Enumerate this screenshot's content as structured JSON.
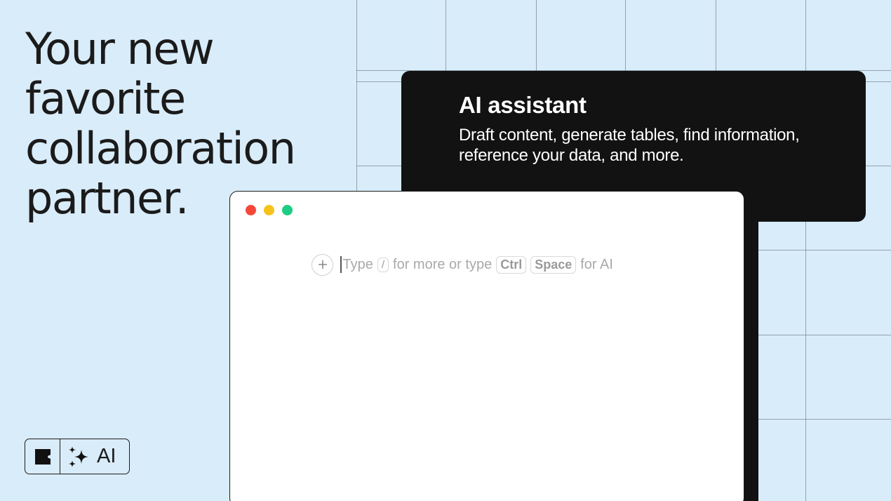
{
  "headline": {
    "lines": [
      "Your new",
      "favorite",
      "collaboration",
      "partner."
    ]
  },
  "feature_card": {
    "title": "AI assistant",
    "description": "Draft content, generate tables, find information, reference your data, and more."
  },
  "editor": {
    "window_controls": [
      "close",
      "minimize",
      "maximize"
    ],
    "placeholder": {
      "before_slash": "Type",
      "slash_key": "/",
      "middle": "for more or type",
      "key1": "Ctrl",
      "key2": "Space",
      "after": "for AI"
    },
    "add_block_icon": "plus-icon"
  },
  "brand": {
    "logo_icon": "coda-logo-icon",
    "sparkle_icon": "sparkles-icon",
    "label": "AI"
  },
  "colors": {
    "background": "#d9ecf9",
    "card": "#121212",
    "close": "#f4473a",
    "minimize": "#f7c21a",
    "maximize": "#1dcd85"
  }
}
